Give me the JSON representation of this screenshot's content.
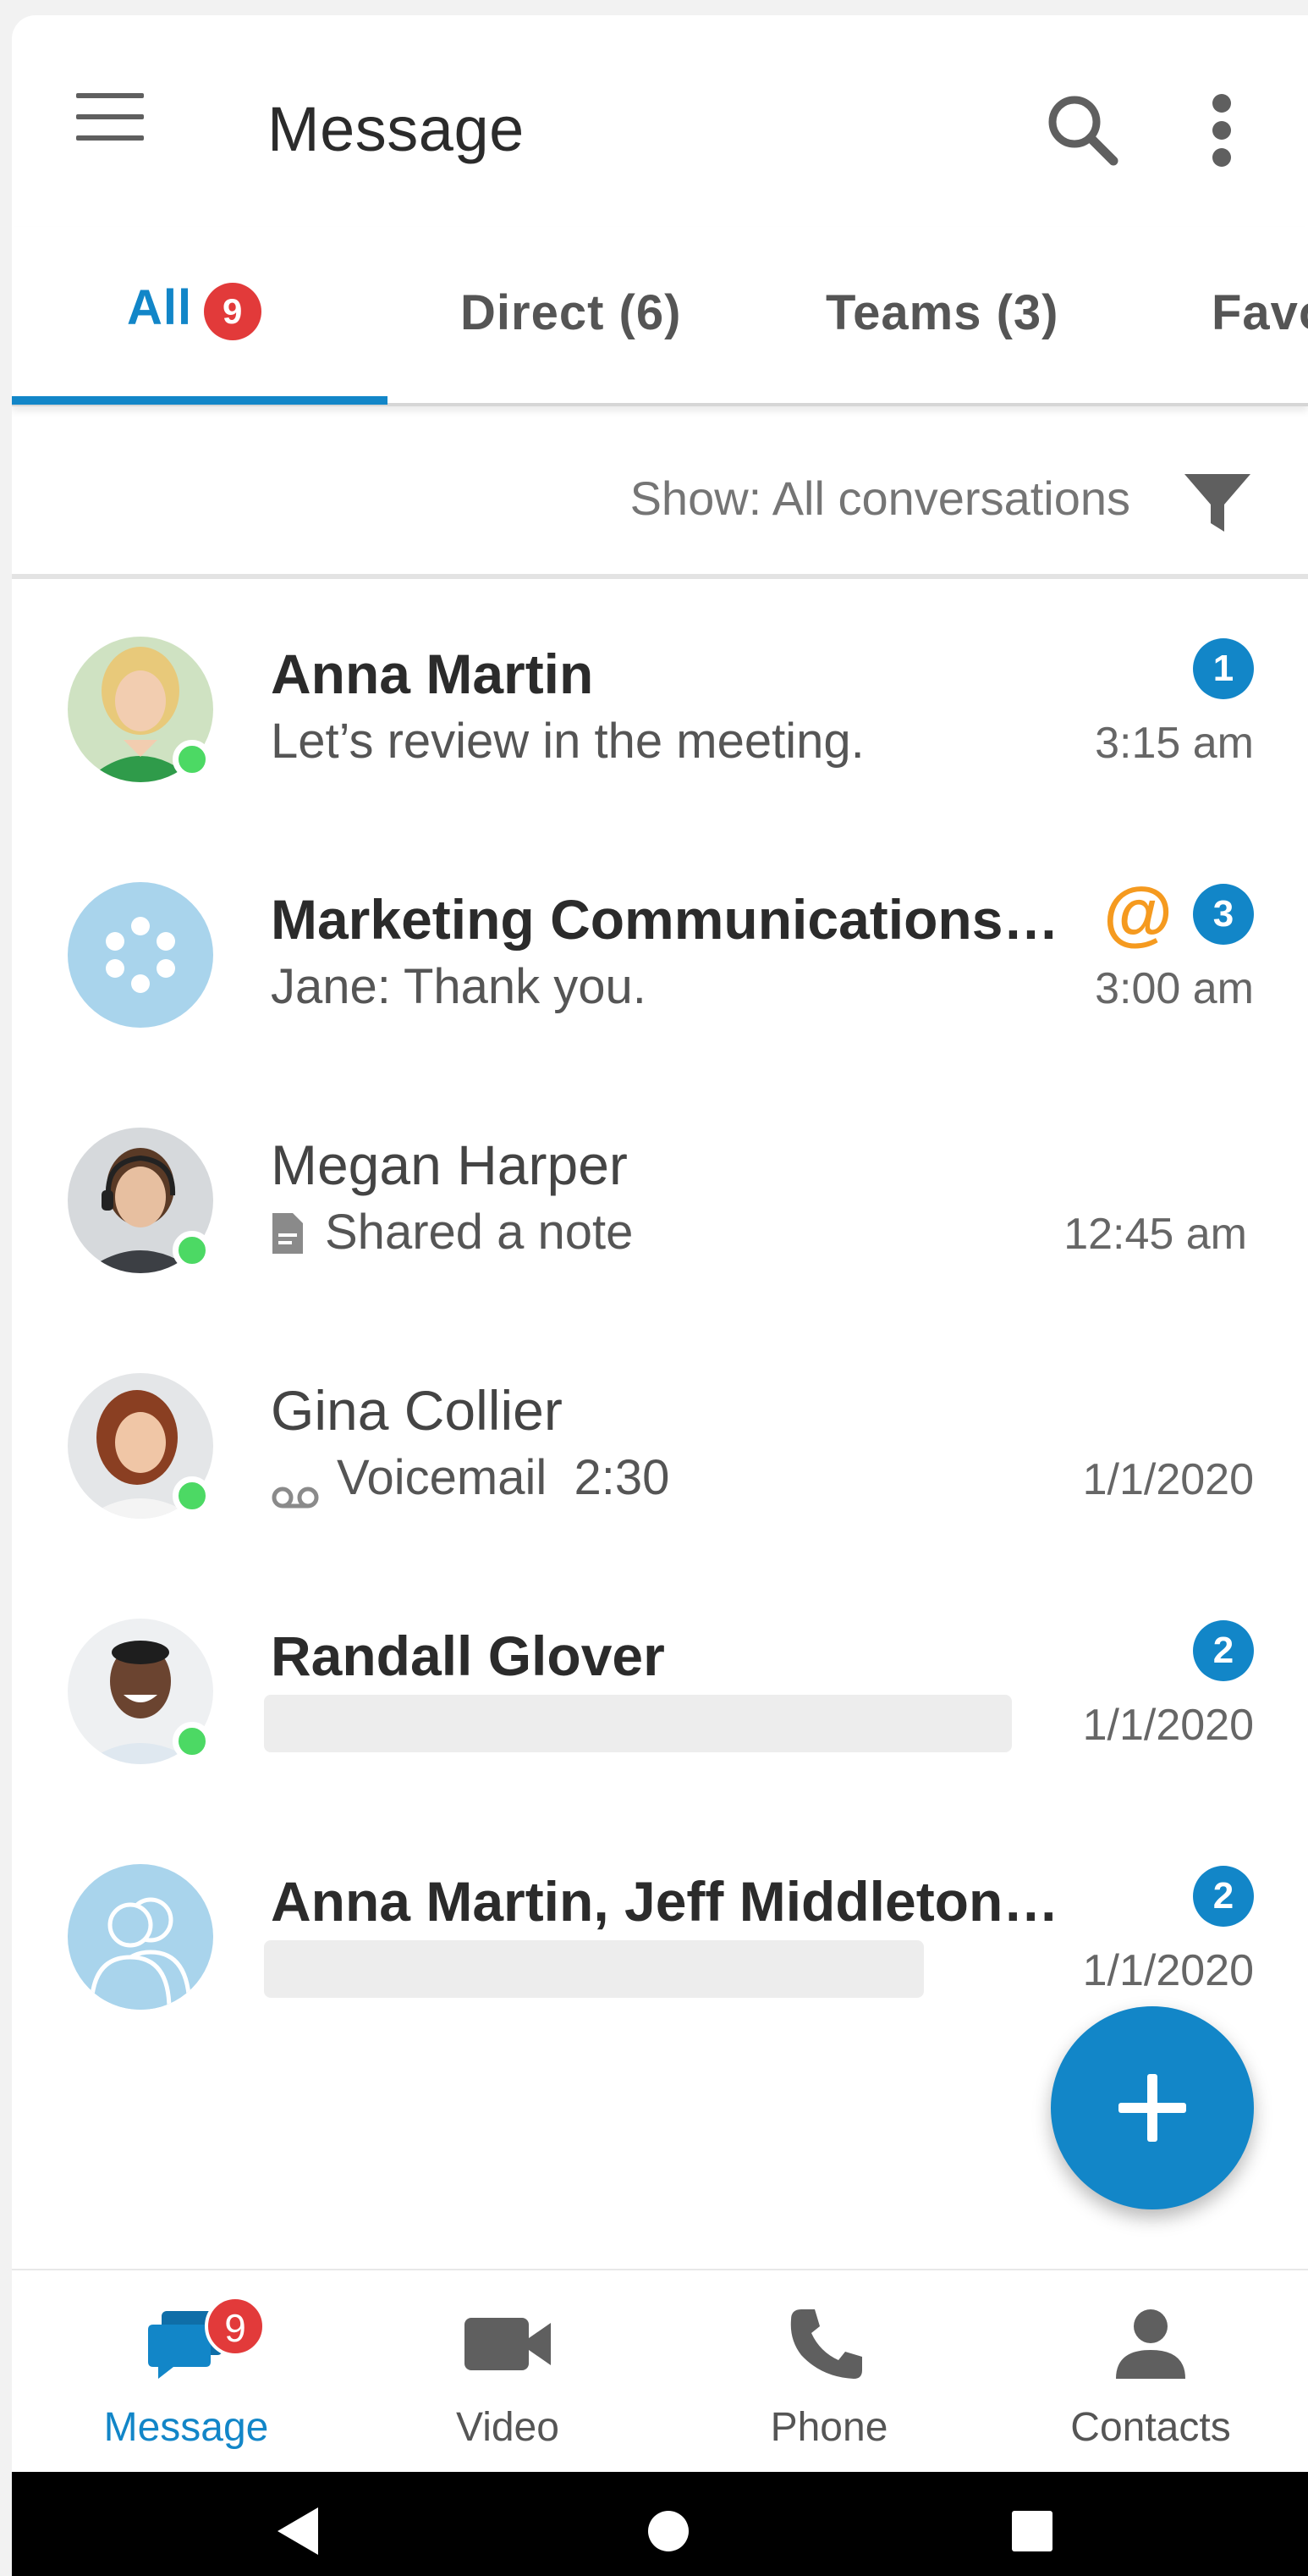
{
  "header": {
    "title": "Message",
    "menu_icon": "hamburger-menu-icon",
    "search_icon": "search-icon",
    "more_icon": "more-vert-icon"
  },
  "tabs": [
    {
      "label": "All",
      "badge": "9",
      "active": true
    },
    {
      "label": "Direct (6)"
    },
    {
      "label": "Teams (3)"
    },
    {
      "label": "Favo"
    }
  ],
  "filter": {
    "label": "Show: All conversations",
    "icon": "filter-icon"
  },
  "conversations": [
    {
      "name": "Anna Martin",
      "preview": "Let’s review in the meeting.",
      "time": "3:15 am",
      "unread": "1",
      "bold": true,
      "presence": "online"
    },
    {
      "name": "Marketing Communications…",
      "preview": "Jane: Thank you.",
      "time": "3:00 am",
      "unread": "3",
      "mention": "@",
      "bold": true
    },
    {
      "name": "Megan Harper",
      "preview": "Shared a note",
      "preview_icon": "note-icon",
      "time": "12:45 am",
      "presence": "online"
    },
    {
      "name": "Gina Collier",
      "preview": "Voicemail  2:30",
      "preview_icon": "voicemail-icon",
      "time": "1/1/2020",
      "presence": "online"
    },
    {
      "name": "Randall Glover",
      "time": "1/1/2020",
      "unread": "2",
      "bold": true,
      "presence": "online"
    },
    {
      "name": "Anna Martin, Jeff Middleton…",
      "time": "1/1/2020",
      "unread": "2",
      "bold": true
    }
  ],
  "fab": {
    "icon": "plus-icon"
  },
  "bottom_nav": [
    {
      "label": "Message",
      "icon": "message-icon",
      "badge": "9",
      "active": true
    },
    {
      "label": "Video",
      "icon": "video-camera-icon"
    },
    {
      "label": "Phone",
      "icon": "phone-icon"
    },
    {
      "label": "Contacts",
      "icon": "person-icon"
    }
  ],
  "colors": {
    "accent": "#1286c8",
    "badge": "#e23a3a",
    "mention": "#f59a1f",
    "presence": "#4cd964"
  }
}
